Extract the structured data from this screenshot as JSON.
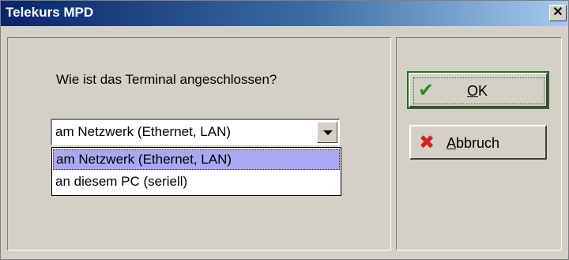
{
  "window": {
    "title": "Telekurs MPD",
    "close_glyph": "✕"
  },
  "dialog": {
    "question": "Wie ist das Terminal angeschlossen?"
  },
  "combobox": {
    "selected_value": "am Netzwerk (Ethernet, LAN)",
    "options": [
      "am Netzwerk (Ethernet, LAN)",
      "an diesem PC (seriell)"
    ],
    "highlighted_index": 0
  },
  "buttons": {
    "ok": {
      "mnemonic": "O",
      "rest": "K",
      "icon": "checkmark-icon",
      "icon_glyph": "✔",
      "icon_color": "#2a8a2a"
    },
    "cancel": {
      "mnemonic": "A",
      "rest": "bbruch",
      "icon": "x-icon",
      "icon_glyph": "✖",
      "icon_color": "#d02020"
    }
  },
  "colors": {
    "title_bar_start": "#0a246a",
    "title_bar_end": "#a6caf0",
    "dialog_background": "#d4d0c8",
    "highlight": "#aaa8f0"
  }
}
